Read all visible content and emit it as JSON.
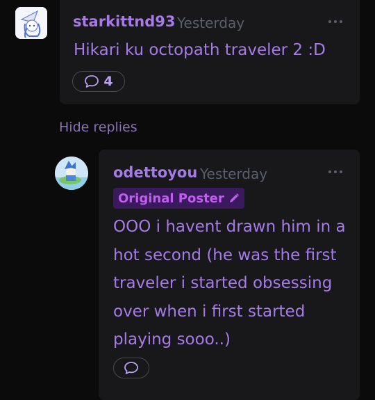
{
  "comment1": {
    "username": "starkittnd93",
    "timestamp": "Yesterday",
    "text": "Hikari ku octopath traveler 2 :D",
    "reply_count": "4"
  },
  "hide_replies_label": "Hide replies",
  "comment2": {
    "username": "odettoyou",
    "timestamp": "Yesterday",
    "badge": "Original Poster",
    "text": "OOO i havent drawn him in a hot second (he was the first traveler i started obsessing over when i first started playing sooo..)"
  },
  "colors": {
    "accent": "#a57be8",
    "background": "#0b0b0c",
    "card": "#18181a",
    "badge_bg": "#3a1a5c",
    "badge_text": "#c35cf0"
  },
  "icons": [
    "avatar-starkittnd93",
    "more-options-icon",
    "speech-bubble-icon",
    "pencil-icon",
    "avatar-odettoyou"
  ]
}
